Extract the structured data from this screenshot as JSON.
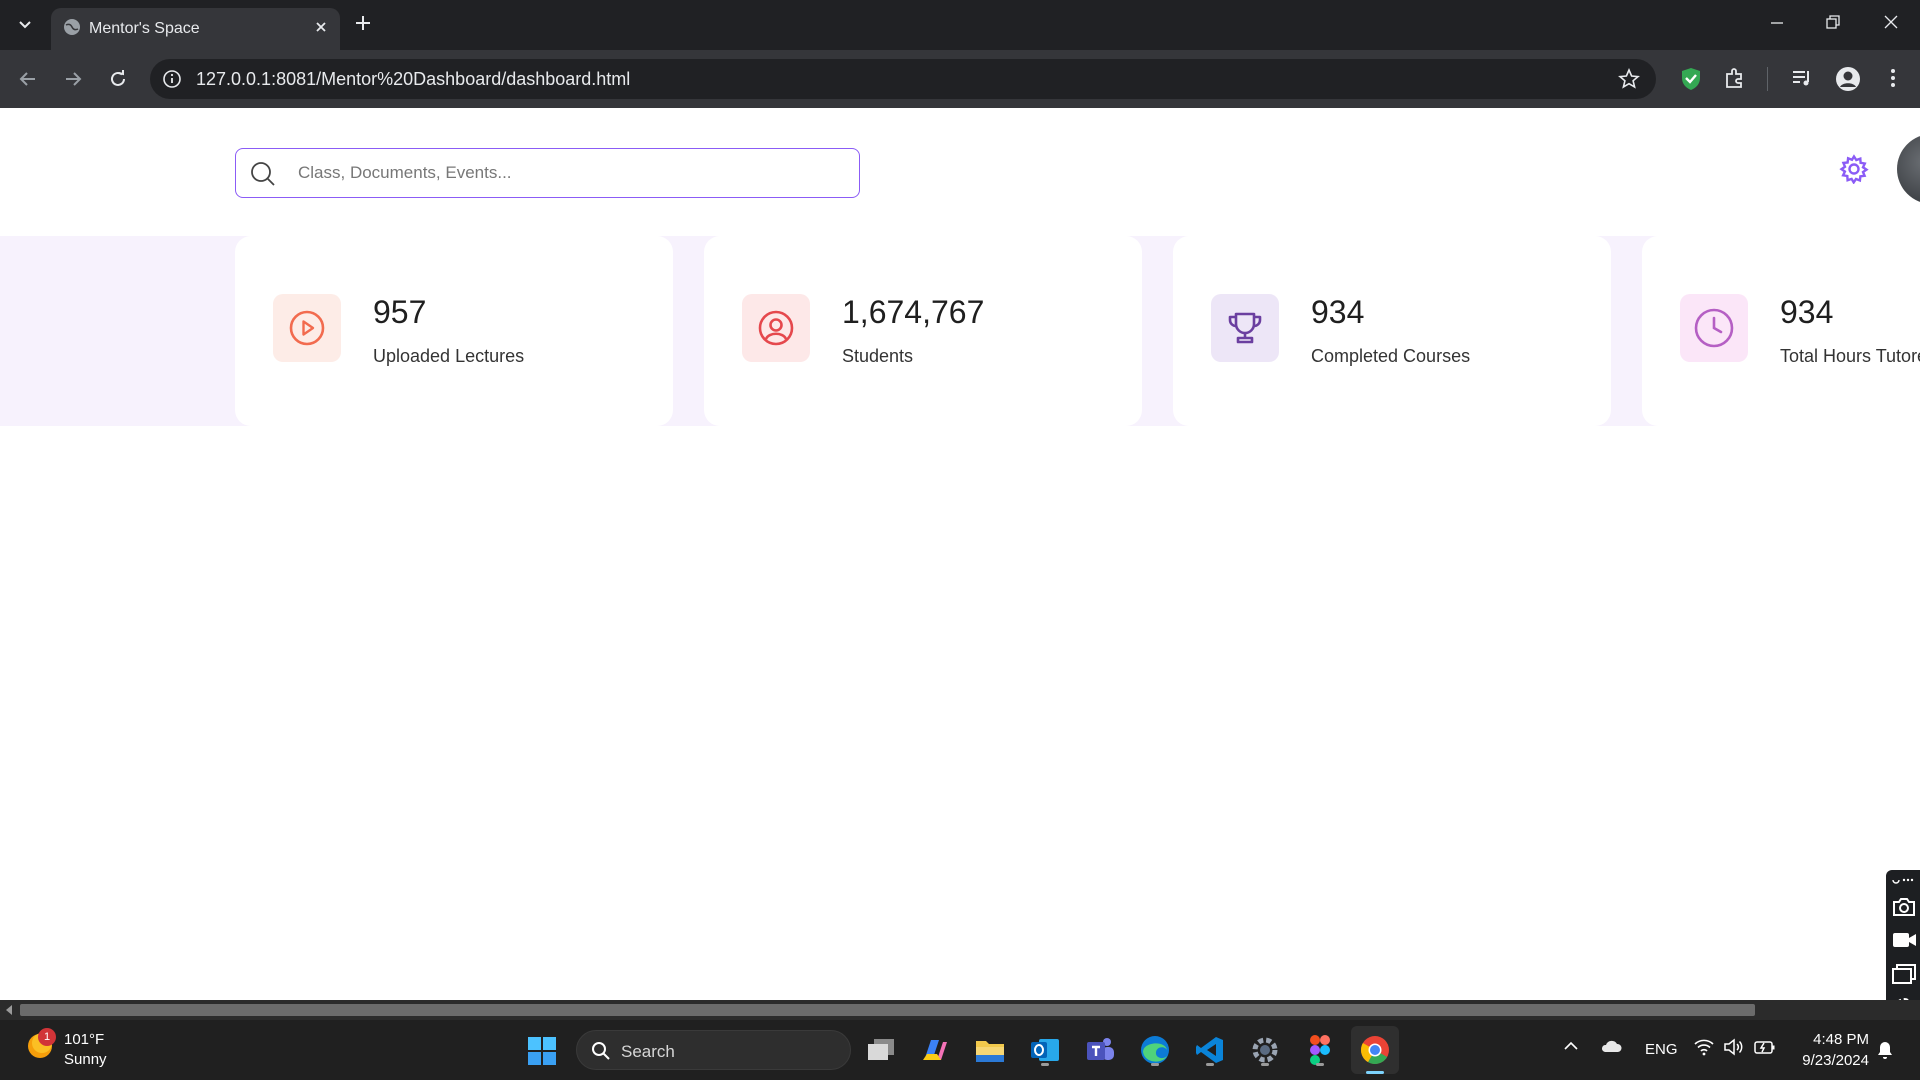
{
  "browser": {
    "tab_title": "Mentor's Space",
    "url": "127.0.0.1:8081/Mentor%20Dashboard/dashboard.html"
  },
  "page": {
    "search": {
      "placeholder": "Class, Documents, Events..."
    },
    "stats": [
      {
        "value": "957",
        "label": "Uploaded Lectures",
        "icon": "play-circle-icon",
        "icon_color": "#f26b4f",
        "icon_bg": "#fdece7"
      },
      {
        "value": "1,674,767",
        "label": "Students",
        "icon": "user-circle-icon",
        "icon_color": "#e5484d",
        "icon_bg": "#fde8e8"
      },
      {
        "value": "934",
        "label": "Completed Courses",
        "icon": "trophy-icon",
        "icon_color": "#6b3fa0",
        "icon_bg": "#ede6f7"
      },
      {
        "value": "934",
        "label": "Total Hours Tutored",
        "icon": "clock-icon",
        "icon_color": "#b55fc4",
        "icon_bg": "#fbe6f8"
      }
    ],
    "accent": "#8b5cf6"
  },
  "taskbar": {
    "weather_alert": "1",
    "weather_temp": "101°F",
    "weather_condition": "Sunny",
    "search_label": "Search",
    "language": "ENG",
    "time": "4:48 PM",
    "date": "9/23/2024"
  }
}
